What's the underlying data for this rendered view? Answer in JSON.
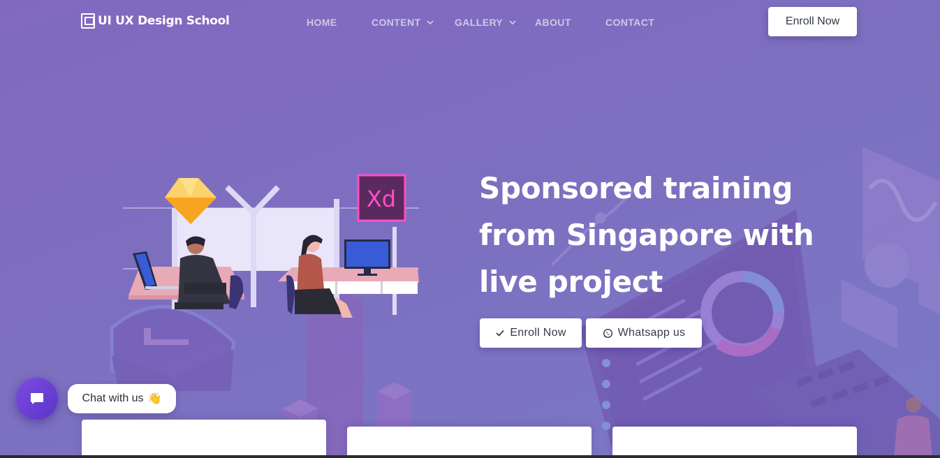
{
  "brand": {
    "name": "UI UX Design School"
  },
  "nav": {
    "items": [
      {
        "label": "HOME",
        "dropdown": false
      },
      {
        "label": "CONTENT",
        "dropdown": true
      },
      {
        "label": "GALLERY",
        "dropdown": true
      },
      {
        "label": "ABOUT",
        "dropdown": false
      },
      {
        "label": "CONTACT",
        "dropdown": false
      }
    ],
    "enroll_label": "Enroll Now"
  },
  "hero": {
    "headline": "Sponsored training from Singapore with live project",
    "buttons": {
      "enroll_label": "Enroll Now",
      "whatsapp_label": "Whatsapp us"
    },
    "badges": {
      "xd": "Xd"
    }
  },
  "chat": {
    "label": "Chat with us",
    "emoji": "👋"
  },
  "colors": {
    "background": "#7d6fbf",
    "accent": "#6a45d6",
    "xd_pink": "#ff4fc8",
    "sketch_yellow": "#f9b72c",
    "button_text": "#333a4a"
  },
  "icons": [
    "logo-icon",
    "chevron-down-icon",
    "check-icon",
    "whatsapp-icon",
    "chat-icon"
  ]
}
